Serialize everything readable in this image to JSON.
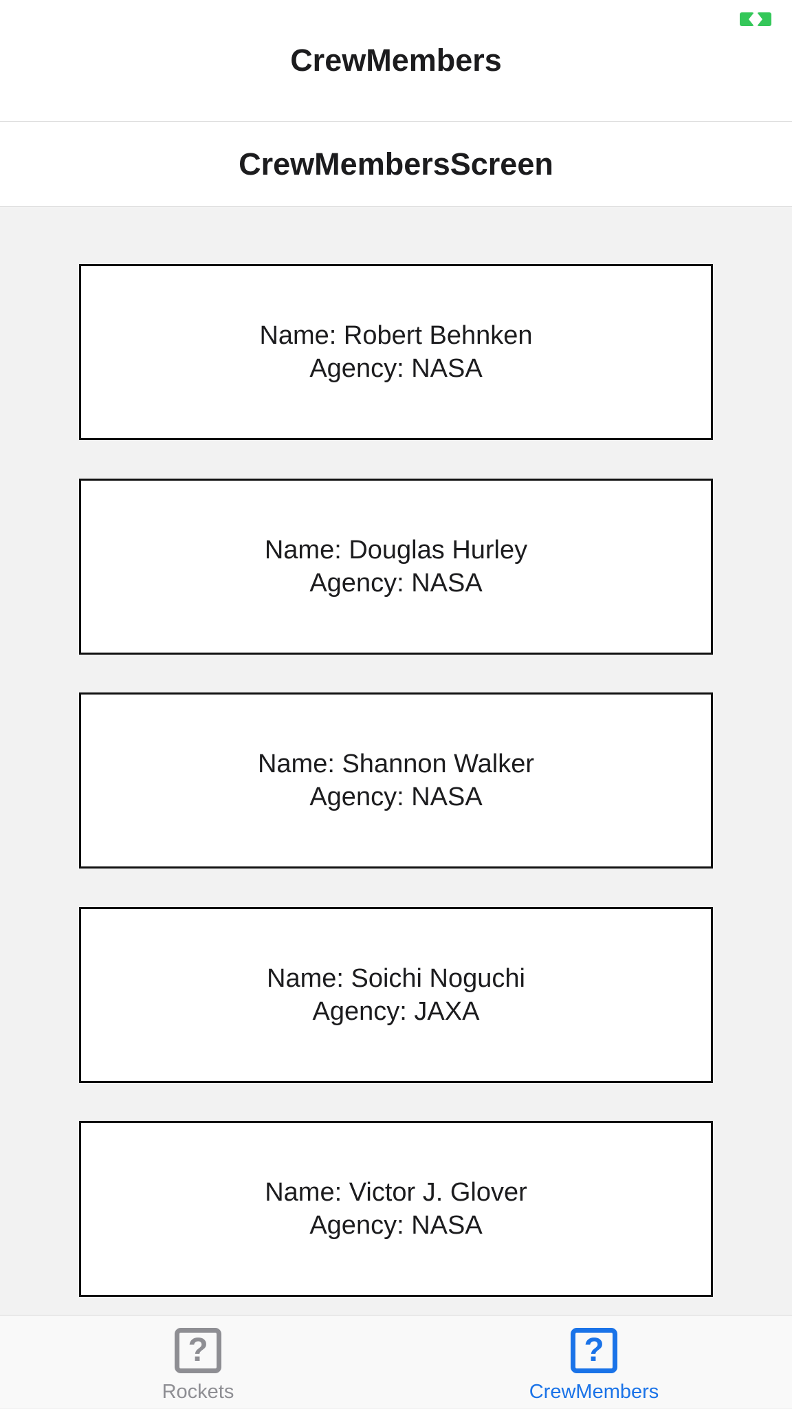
{
  "nav": {
    "title": "CrewMembers"
  },
  "screen": {
    "title": "CrewMembersScreen"
  },
  "crew": [
    {
      "name_line": "Name: Robert Behnken",
      "agency_line": "Agency: NASA"
    },
    {
      "name_line": "Name: Douglas Hurley",
      "agency_line": "Agency: NASA"
    },
    {
      "name_line": "Name: Shannon Walker",
      "agency_line": "Agency: NASA"
    },
    {
      "name_line": "Name: Soichi Noguchi",
      "agency_line": "Agency: JAXA"
    },
    {
      "name_line": "Name: Victor J. Glover",
      "agency_line": "Agency: NASA"
    }
  ],
  "tabs": [
    {
      "label": "Rockets",
      "icon": "question-mark-icon",
      "active": false
    },
    {
      "label": "CrewMembers",
      "icon": "question-mark-icon",
      "active": true
    }
  ],
  "icons": {
    "tab_glyph": "?"
  },
  "colors": {
    "accent": "#1a73e8",
    "inactive": "#8e8e93",
    "status_green": "#34c759",
    "background": "#f2f2f2",
    "card_border": "#111111"
  }
}
